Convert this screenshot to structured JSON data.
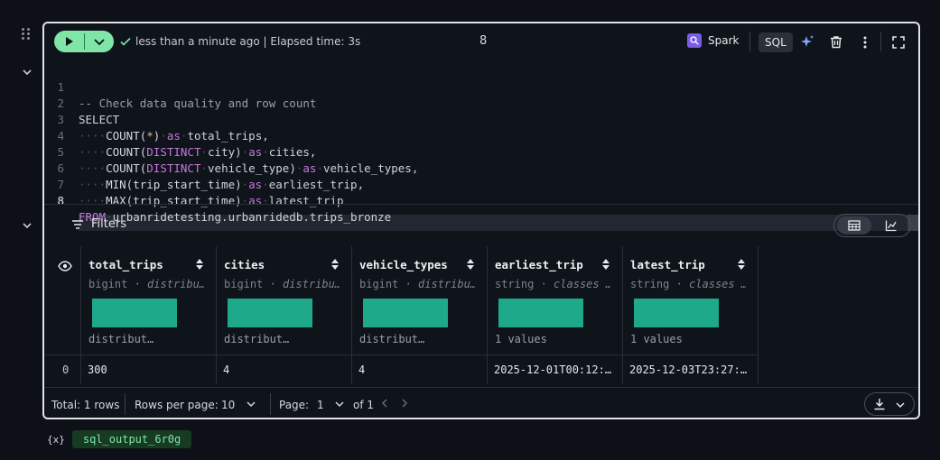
{
  "toolbar": {
    "status_text": "less than a minute ago | Elapsed time: 3s",
    "execution_count": "8",
    "engine_label": "Spark",
    "language_label": "SQL"
  },
  "editor": {
    "line_numbers": [
      "1",
      "2",
      "3",
      "4",
      "5",
      "6",
      "7",
      "8"
    ],
    "line1": "-- Check data quality and row count",
    "line2_kw": "SELECT",
    "line3": {
      "fn": "COUNT(",
      "op": "*",
      "close": ")",
      "as": "as",
      "alias": "total_trips,"
    },
    "line4": {
      "fn": "COUNT(",
      "kw": "DISTINCT",
      "arg": "city)",
      "as": "as",
      "alias": "cities,"
    },
    "line5": {
      "fn": "COUNT(",
      "kw": "DISTINCT",
      "arg": "vehicle_type)",
      "as": "as",
      "alias": "vehicle_types,"
    },
    "line6": {
      "fn": "MIN(trip_start_time)",
      "as": "as",
      "alias": "earliest_trip,"
    },
    "line7": {
      "fn": "MAX(trip_start_time)",
      "as": "as",
      "alias": "latest_trip"
    },
    "line8": {
      "kw": "FROM",
      "table": "urbanridetesting.urbanridedb.trips_bronze"
    }
  },
  "results": {
    "filters_label": "Filters",
    "columns": [
      {
        "name": "total_trips",
        "type": "bigint",
        "dot": " · ",
        "type_detail": "distribu…",
        "summary": "distribut…"
      },
      {
        "name": "cities",
        "type": "bigint",
        "dot": " · ",
        "type_detail": "distribu…",
        "summary": "distribut…"
      },
      {
        "name": "vehicle_types",
        "type": "bigint",
        "dot": " · ",
        "type_detail": "distribu…",
        "summary": "distribut…"
      },
      {
        "name": "earliest_trip",
        "type": "string",
        "dot": " · ",
        "type_detail": "classes …",
        "summary": "1 values"
      },
      {
        "name": "latest_trip",
        "type": "string",
        "dot": " · ",
        "type_detail": "classes …",
        "summary": "1 values"
      }
    ],
    "rows": [
      {
        "index": "0",
        "values": [
          "300",
          "4",
          "4",
          "2025-12-01T00:12:…",
          "2025-12-03T23:27:…"
        ]
      }
    ]
  },
  "footer": {
    "total_rows": "Total: 1 rows",
    "rows_per_page_label": "Rows per page:",
    "rows_per_page_value": "10",
    "page_label": "Page:",
    "page_value": "1",
    "page_of": "of 1"
  },
  "output_variable": {
    "icon_text": "{x}",
    "name": "sql_output_6r0g"
  },
  "colors": {
    "run_button": "#7fe6a8",
    "distribution_bar": "#1fa98b",
    "keyword": "#c678dd",
    "spark_icon": "#7b5ce6"
  }
}
